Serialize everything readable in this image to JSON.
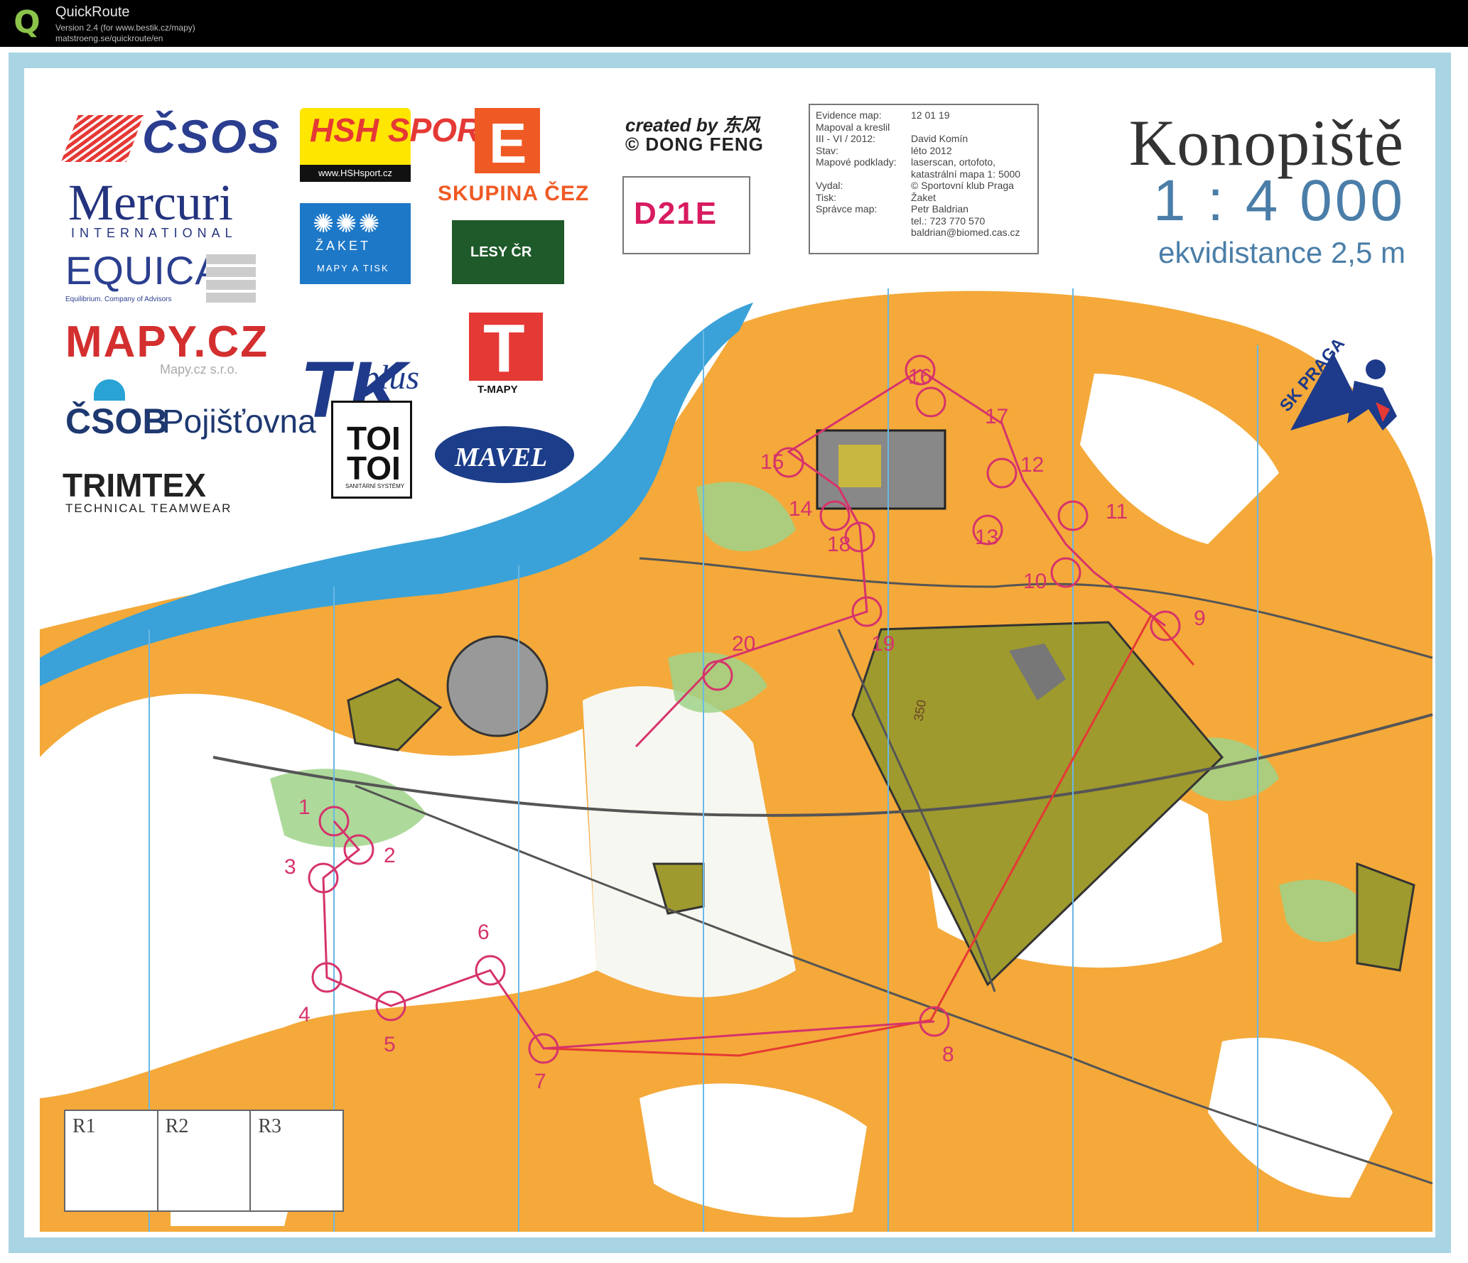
{
  "app": {
    "logo_letter": "Q",
    "name": "QuickRoute",
    "version": "Version 2.4  (for www.bestik.cz/mapy)",
    "url": "matstroeng.se/quickroute/en"
  },
  "sponsors": {
    "csos": "ČSOS",
    "mercuri": "Mercuri",
    "mercuri_sub": "INTERNATIONAL",
    "equica": "EQUICA",
    "equica_sub": "Equilibrium. Company of Advisors",
    "mapy": "MAPY.CZ",
    "mapy_sub": "Mapy.cz s.r.o.",
    "csob": "ČSOB",
    "csob_b": "Pojišťovna",
    "trimtex": "TRIMTEX",
    "trimtex_sub": "TECHNICAL TEAMWEAR",
    "hsh": "HSH SPORT",
    "hsh_url": "www.HSHsport.cz",
    "zaket": "ŽAKET",
    "zaket_sub": "MAPY A TISK",
    "tk": "TK",
    "tk_plus": "plus",
    "toi1": "TOI",
    "toi2": "TOI",
    "toi_sub": "SANITÁRNÍ SYSTÉMY",
    "cez_letter": "E",
    "cez": "SKUPINA ČEZ",
    "lesy": "LESY ČR",
    "tmapy_letter": "T",
    "tmapy": "T-MAPY",
    "mavel": "MAVEL"
  },
  "credit": {
    "line1": "created by 东风",
    "line2": "© DONG FENG"
  },
  "class_code": "D21E",
  "info": {
    "rows": [
      {
        "label": "Evidence map:",
        "value": "12 01 19"
      },
      {
        "label": "Mapoval a kreslil",
        "value": ""
      },
      {
        "label": "III - VI / 2012:",
        "value": "David Komín"
      },
      {
        "label": "Stav:",
        "value": "léto 2012"
      },
      {
        "label": "Mapové podklady:",
        "value": "laserscan, ortofoto,"
      },
      {
        "label": "",
        "value": "katastrální mapa 1: 5000"
      },
      {
        "label": "Vydal:",
        "value": "© Sportovní klub Praga"
      },
      {
        "label": "Tisk:",
        "value": "Žaket"
      },
      {
        "label": "Správce map:",
        "value": "Petr Baldrian"
      },
      {
        "label": "",
        "value": "tel.: 723 770 570"
      },
      {
        "label": "",
        "value": "baldrian@biomed.cas.cz"
      }
    ]
  },
  "map": {
    "title": "Konopiště",
    "scale": "1 : 4 000",
    "contour": "ekvidistance 2,5 m",
    "club_logo": "SK PRAGA",
    "contour_value": "350",
    "result_cells": [
      "R1",
      "R2",
      "R3"
    ],
    "colors": {
      "open_land": "#f4a93a",
      "forest": "#ffffff",
      "green": "#9fd38a",
      "water": "#3aa2d8",
      "olive": "#9e9a2e",
      "course": "#d6336c",
      "route": "#e53935"
    },
    "controls": [
      {
        "label": "1"
      },
      {
        "label": "2"
      },
      {
        "label": "3"
      },
      {
        "label": "4"
      },
      {
        "label": "5"
      },
      {
        "label": "6"
      },
      {
        "label": "7"
      },
      {
        "label": "8"
      },
      {
        "label": "9"
      },
      {
        "label": "10"
      },
      {
        "label": "11"
      },
      {
        "label": "12"
      },
      {
        "label": "13"
      },
      {
        "label": "14"
      },
      {
        "label": "15"
      },
      {
        "label": "16"
      },
      {
        "label": "17"
      },
      {
        "label": "18"
      },
      {
        "label": "19"
      },
      {
        "label": "20"
      }
    ]
  }
}
